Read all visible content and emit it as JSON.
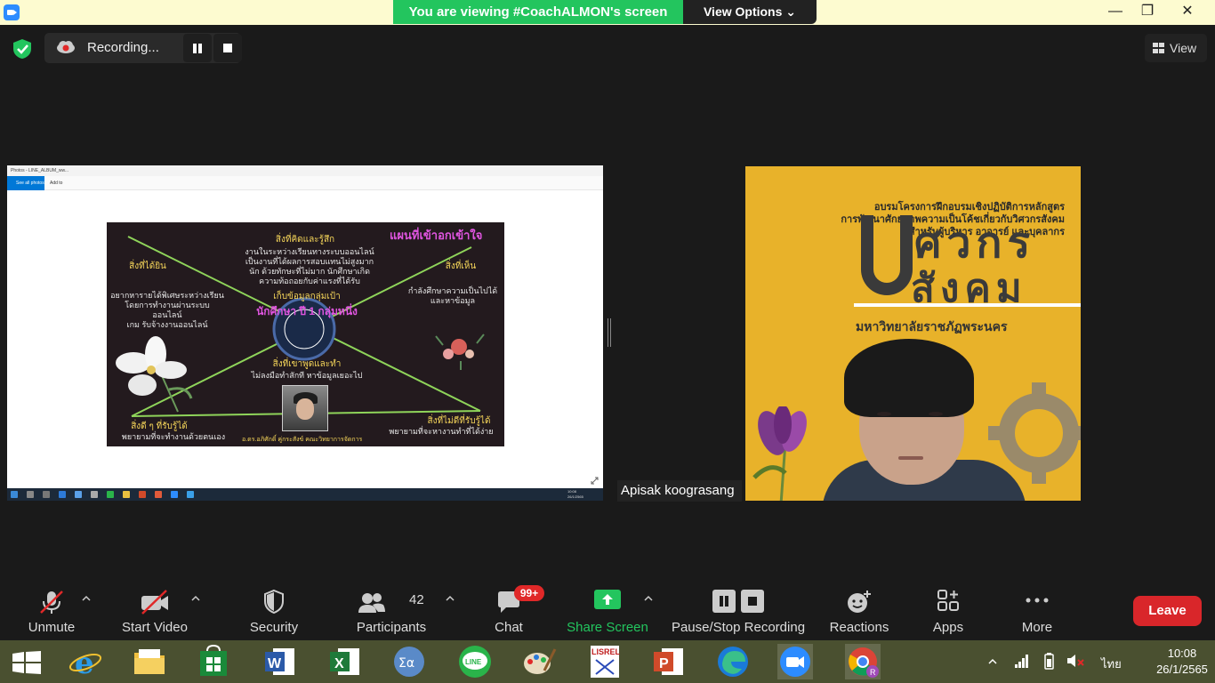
{
  "titlebar": {
    "banner": "You are viewing #CoachALMON's screen",
    "view_options": "View Options"
  },
  "recording": {
    "label": "Recording..."
  },
  "view_button": {
    "label": "View"
  },
  "shared_screen": {
    "photos_title": "Photos - LINE_ALBUM_ww...",
    "see_all": "See all photos",
    "add_to": "Add to",
    "slide": {
      "title": "แผนที่เข้าอกเข้าใจ",
      "think_feel_head": "สิ่งที่คิดและรู้สึก",
      "think_feel_body": "งานในระหว่างเรียนทางระบบออนไลน์\nเป็นงานที่ได้ผลการสอบแทนไม่สูงมาก\nนัก ด้วยทักษะที่ไม่มาก นักศึกษาเกิด\nความท้อถอยกับค่าแรงที่ได้รับ",
      "hear_head": "สิ่งที่ได้ยิน",
      "hear_body": "อยากหารายได้พิเศษระหว่างเรียน\nโดยการทำงานผ่านระบบออนไลน์\nเกม รับจ้างงานออนไลน์",
      "see_head": "สิ่งที่เห็น",
      "see_body": "กำลังศึกษาความเป็นไปได้\nและหาข้อมูล",
      "center_1": "เก็บข้อมูลกลุ่มเป้า",
      "center_2": "นักศึกษา ปี 1 กลุ่มหนึ่ง",
      "say_do_head": "สิ่งที่เขาพูดและทำ",
      "say_do_body": "ไม่ลงมือทำสักที หาข้อมูลเยอะไป",
      "pain_head": "สิ่งดี ๆ ที่รับรู้ได้",
      "pain_body": "พยายามที่จะทำงานด้วยตนเอง",
      "gain_head": "สิ่งที่ไม่ดีที่รับรู้ได้",
      "gain_body": "พยายามที่จะหางานทำที่ได้ง่าย",
      "footer": "อ.ดร.อภิศักดิ์ คู่กระสังข์ คณะวิทยาการจัดการ"
    },
    "inner_clock": "10:08\n26/1/2565"
  },
  "participant": {
    "name": "Apisak koograsang",
    "bg_line1": "อบรมโครงการฝึกอบรมเชิงปฏิบัติการหลักสูตร",
    "bg_line2": "การพัฒนาศักยภาพความเป็นโค้ชเกี่ยวกับวิศวกรสังคม",
    "bg_line3": "สำหรับผู้บริหาร อาจารย์ และบุคลากร",
    "bg_big1": "ศวกร",
    "bg_big2": "สังคม",
    "bg_univ": "มหาวิทยาลัยราชภัฏพระนคร"
  },
  "toolbar": {
    "unmute": "Unmute",
    "start_video": "Start Video",
    "security": "Security",
    "participants": "Participants",
    "participants_count": "42",
    "chat": "Chat",
    "chat_badge": "99+",
    "share_screen": "Share Screen",
    "pause_stop": "Pause/Stop Recording",
    "reactions": "Reactions",
    "apps": "Apps",
    "more": "More",
    "leave": "Leave"
  },
  "taskbar": {
    "lang": "ไทย",
    "time": "10:08",
    "date": "26/1/2565"
  },
  "colors": {
    "zoom_bg": "#1a1a1a",
    "green": "#23c55e",
    "leave_red": "#d9262a",
    "taskbar": "#4a5030",
    "video_bg": "#e8b22a"
  }
}
